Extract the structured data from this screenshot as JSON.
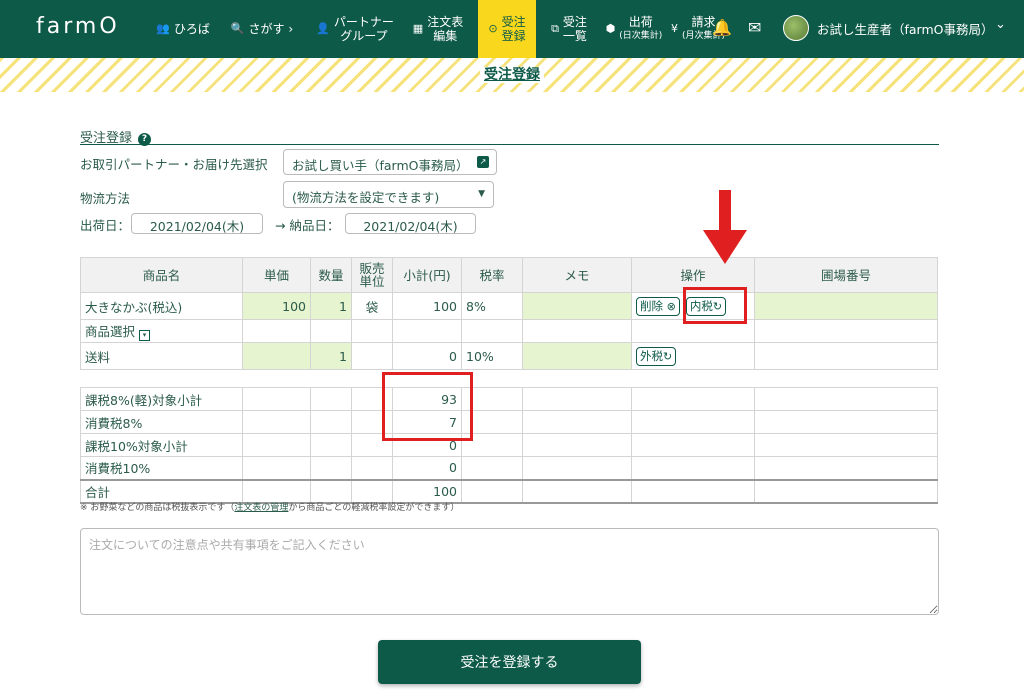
{
  "header": {
    "logo": "farmO",
    "nav": [
      {
        "icon": "users-icon",
        "glyph": "👥",
        "label": "ひろば"
      },
      {
        "icon": "search-icon",
        "glyph": "🔍",
        "label": "さがす ›"
      },
      {
        "icon": "person-icon",
        "glyph": "👤",
        "label1": "パートナー",
        "label2": "グループ"
      },
      {
        "icon": "table-icon",
        "glyph": "▦",
        "label1": "注文表",
        "label2": "編集"
      },
      {
        "icon": "check-circle-icon",
        "glyph": "⊙",
        "label1": "受注",
        "label2": "登録"
      },
      {
        "icon": "list-icon",
        "glyph": "⧉",
        "label1": "受注",
        "label2": "一覧"
      },
      {
        "icon": "box-icon",
        "glyph": "⬢",
        "label1": "出荷",
        "label2": "(日次集計)"
      },
      {
        "icon": "yen-icon",
        "glyph": "¥",
        "label1": "請求",
        "label2": "(月次集計)"
      }
    ],
    "bell_glyph": "🔔",
    "mail_glyph": "✉",
    "user_name": "お試し生産者（farmO事務局）",
    "chevron_glyph": "⌄"
  },
  "page_title": "受注登録",
  "form": {
    "section_title": "受注登録",
    "help_glyph": "?",
    "partner_label": "お取引パートナー・お届け先選択",
    "partner_value": "お試し買い手（farmO事務局）",
    "partner_icon_glyph": "↗",
    "logistics_label": "物流方法",
    "logistics_value": "(物流方法を設定できます)",
    "select_arrow": "▼",
    "ship_label": "出荷日：",
    "ship_date": "2021/02/04(木)",
    "arrow_delivery": "→ 納品日：",
    "delivery_date": "2021/02/04(木)"
  },
  "items_table": {
    "headers": [
      "商品名",
      "単価",
      "数量",
      "販売\n単位",
      "小計(円)",
      "税率",
      "メモ",
      "操作",
      "圃場番号"
    ],
    "rows": [
      {
        "name": "大きなかぶ(税込)",
        "price": "100",
        "qty": "1",
        "unit": "袋",
        "subtotal": "100",
        "tax": "8%",
        "memo": "",
        "delete_label": "削除",
        "delete_glyph": "⊗",
        "tax_btn": "内税",
        "refresh_glyph": "↻"
      },
      {
        "name": "商品選択",
        "dropdown_glyph": "▾"
      },
      {
        "name": "送料",
        "price": "",
        "qty": "1",
        "unit": "",
        "subtotal": "0",
        "tax": "10%",
        "memo": "",
        "tax_btn": "外税",
        "refresh_glyph": "↻"
      }
    ]
  },
  "summary_table": {
    "rows": [
      {
        "label": "課税8%(軽)対象小計",
        "value": "93"
      },
      {
        "label": "消費税8%",
        "value": "7"
      },
      {
        "label": "課税10%対象小計",
        "value": "0"
      },
      {
        "label": "消費税10%",
        "value": "0"
      },
      {
        "label": "合計",
        "value": "100"
      }
    ]
  },
  "note": {
    "prefix": "※ お野菜などの商品は税抜表示です（",
    "link": "注文表の管理",
    "suffix": "から商品ごとの軽減税率設定ができます）"
  },
  "comment_placeholder": "注文についての注意点や共有事項をご記入ください",
  "submit_label": "受注を登録する",
  "colors": {
    "brand": "#0e5a48",
    "active_tab": "#f8d71c",
    "editable_cell": "#e6f5d0",
    "annotation": "#e02020"
  }
}
